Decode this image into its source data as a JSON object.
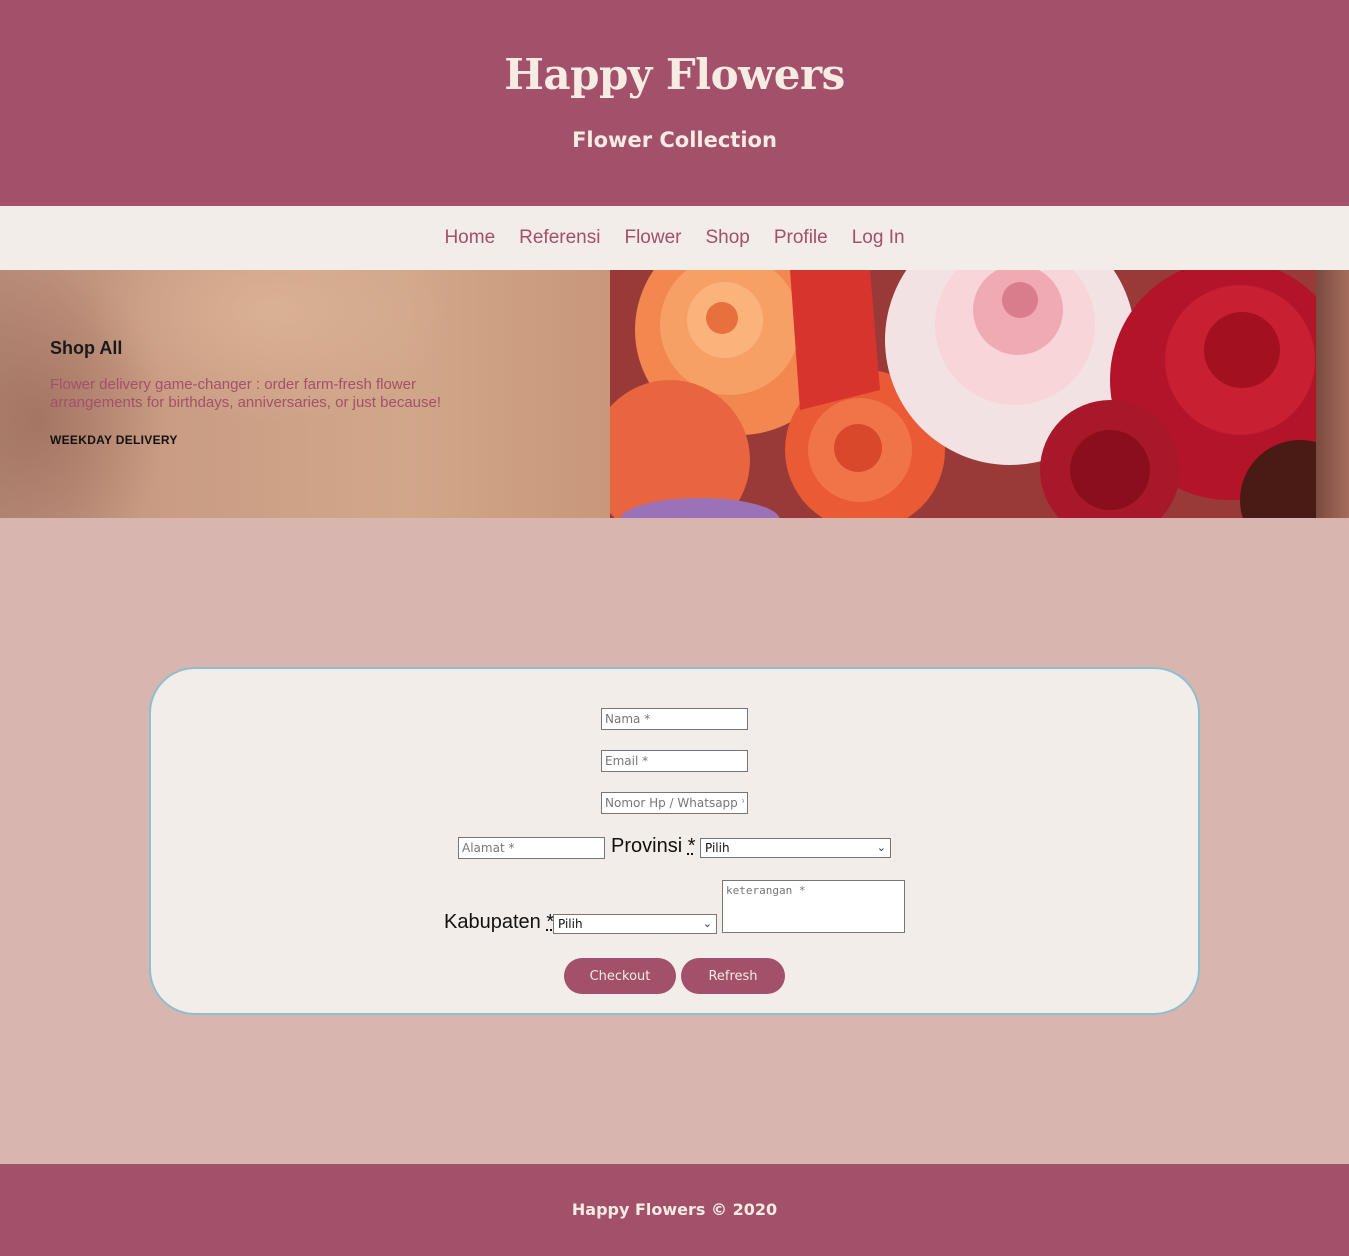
{
  "header": {
    "title": "Happy Flowers",
    "subtitle": "Flower Collection"
  },
  "nav": {
    "items": [
      "Home",
      "Referensi",
      "Flower",
      "Shop",
      "Profile",
      "Log In"
    ]
  },
  "hero": {
    "title": "Shop All",
    "description": "Flower delivery game-changer : order farm-fresh flower arrangements for birthdays, anniversaries, or just because!",
    "cta": "WEEKDAY DELIVERY"
  },
  "form": {
    "nama_placeholder": "Nama *",
    "email_placeholder": "Email *",
    "phone_placeholder": "Nomor Hp / Whatsapp *",
    "alamat_placeholder": "Alamat *",
    "provinsi_label": "Provinsi",
    "kabupaten_label": "Kabupaten",
    "required_mark": "*",
    "provinsi_value": "Pilih",
    "kabupaten_value": "Pilih",
    "keterangan_placeholder": "keterangan *",
    "checkout_label": "Checkout",
    "refresh_label": "Refresh"
  },
  "footer": {
    "text": "Happy Flowers © 2020"
  },
  "colors": {
    "brand": "#a3506a",
    "cream": "#f3ede9",
    "page_bg": "#d9b5b0",
    "card_border": "#8cbfcf"
  }
}
